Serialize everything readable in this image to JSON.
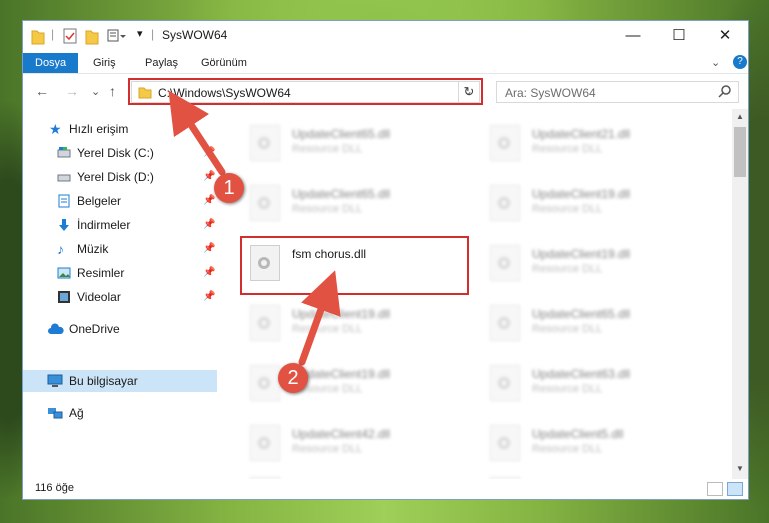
{
  "window": {
    "title": "SysWOW64",
    "minimize": "—",
    "maximize": "☐",
    "close": "✕",
    "help": "?"
  },
  "ribbon": {
    "tabs": [
      "Dosya",
      "Giriş",
      "Paylaş",
      "Görünüm"
    ],
    "expand": "⌄"
  },
  "address": {
    "path": "C:\\Windows\\SysWOW64",
    "dropdown": "⌄",
    "refresh": "↻"
  },
  "search": {
    "placeholder": "Ara: SysWOW64"
  },
  "nav_buttons": {
    "back": "←",
    "forward": "→",
    "recent": "⌄",
    "up": "↑"
  },
  "sidebar": {
    "items": [
      {
        "label": "Hızlı erişim",
        "pinned": false
      },
      {
        "label": "Yerel Disk (C:)",
        "pinned": true
      },
      {
        "label": "Yerel Disk (D:)",
        "pinned": true
      },
      {
        "label": "Belgeler",
        "pinned": true
      },
      {
        "label": "İndirmeler",
        "pinned": true
      },
      {
        "label": "Müzik",
        "pinned": true
      },
      {
        "label": "Resimler",
        "pinned": true
      },
      {
        "label": "Videolar",
        "pinned": true
      },
      {
        "label": "OneDrive",
        "pinned": false
      },
      {
        "label": "Bu bilgisayar",
        "pinned": false,
        "selected": true
      },
      {
        "label": "Ağ",
        "pinned": false
      }
    ]
  },
  "files": [
    {
      "name": "UpdateClient65.dll",
      "type": "Resource DLL"
    },
    {
      "name": "UpdateClient21.dll",
      "type": "Resource DLL"
    },
    {
      "name": "UpdateClient65.dll",
      "type": "Resource DLL"
    },
    {
      "name": "UpdateClient19.dll",
      "type": "Resource DLL"
    },
    {
      "name": "fsm chorus.dll",
      "type": ""
    },
    {
      "name": "UpdateClient19.dll",
      "type": "Resource DLL"
    },
    {
      "name": "UpdateClient19.dll",
      "type": "Resource DLL"
    },
    {
      "name": "UpdateClient65.dll",
      "type": "Resource DLL"
    },
    {
      "name": "UpdateClient19.dll",
      "type": "Resource DLL"
    },
    {
      "name": "UpdateClient63.dll",
      "type": "Resource DLL"
    },
    {
      "name": "UpdateClient42.dll",
      "type": "Resource DLL"
    },
    {
      "name": "UpdateClient5.dll",
      "type": "Resource DLL"
    },
    {
      "name": "",
      "type": ""
    },
    {
      "name": "",
      "type": ""
    }
  ],
  "status": {
    "item_count": "116 öğe"
  },
  "callouts": {
    "one": "1",
    "two": "2"
  },
  "colors": {
    "accent": "#1979ca",
    "highlight": "#d32e2e",
    "callout": "#e25243",
    "selection": "#cce4f7"
  }
}
